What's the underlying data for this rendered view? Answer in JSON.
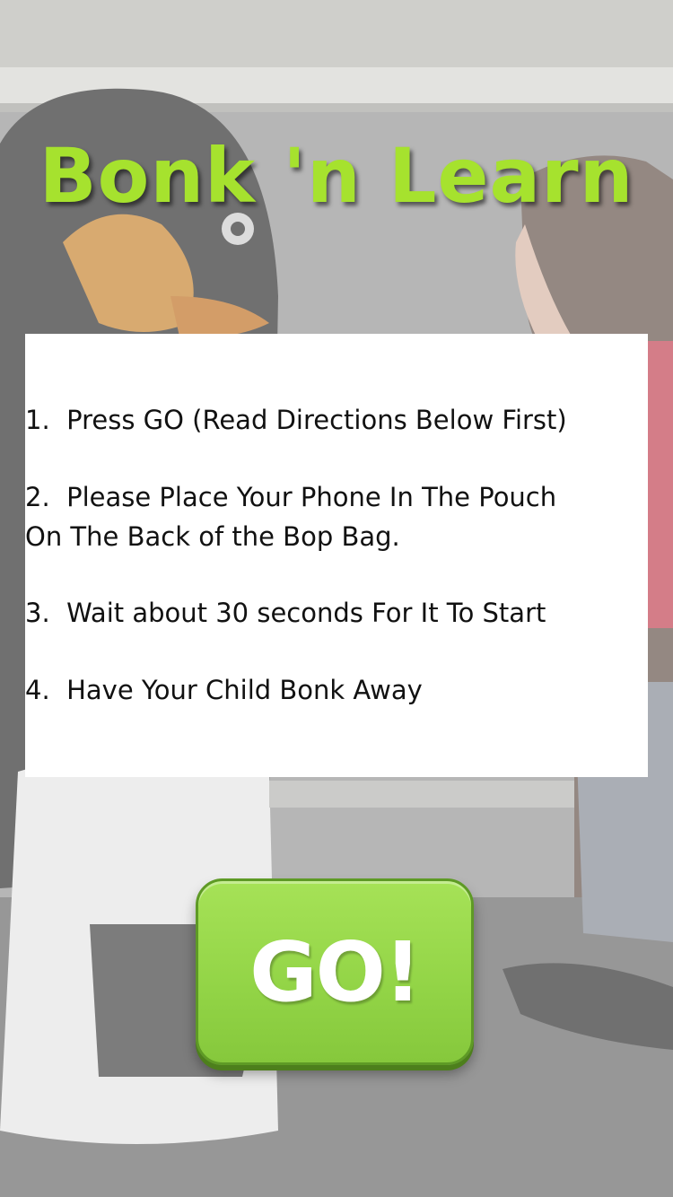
{
  "app": {
    "title": "Bonk 'n Learn"
  },
  "instructions": {
    "steps": [
      "1.  Press GO (Read Directions Below First)",
      "2.  Please Place Your Phone In The Pouch\nOn The Back of the Bop Bag.",
      "3.  Wait about 30 seconds For It To Start",
      "4.  Have Your Child Bonk Away"
    ]
  },
  "go_button": {
    "label": "GO!"
  },
  "colors": {
    "title": "#a6e22e",
    "button": "#92d446",
    "panel": "#ffffff"
  },
  "background": {
    "icon": "penguin-bop-bag-and-child-photo"
  }
}
